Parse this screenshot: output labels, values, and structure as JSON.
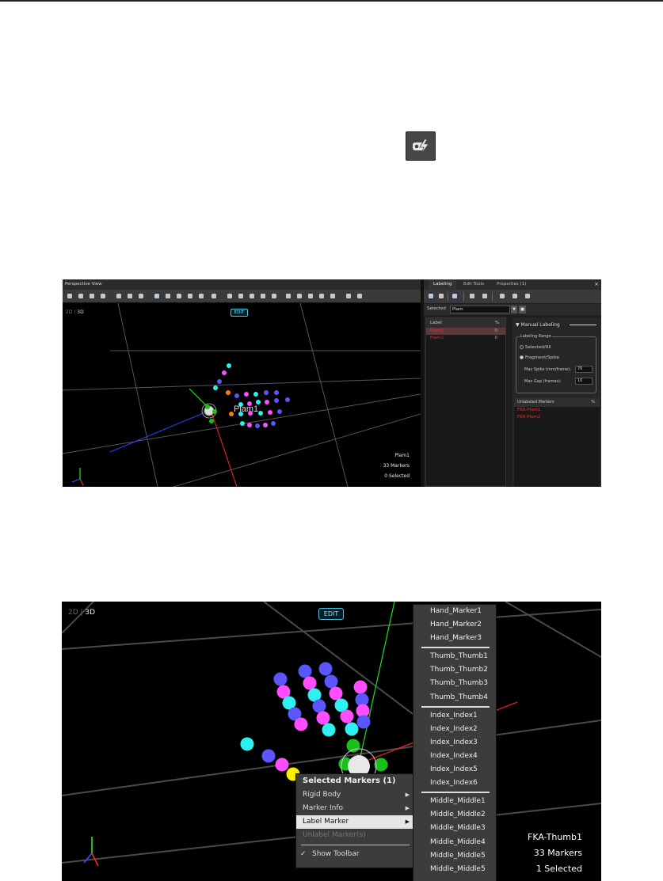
{
  "icon": {
    "name": "label-tool-icon"
  },
  "shot1": {
    "title": "Perspective View",
    "mode_2d": "2D",
    "mode_3d": "3D",
    "edit": "EDIT",
    "marker_label": "Plam1",
    "info": {
      "asset": "Plam1",
      "markers": "33 Markers",
      "selected": "0 Selected"
    },
    "panel": {
      "tabs": [
        "Labeling",
        "Edit Tools",
        "Properties (1)"
      ],
      "close": "×",
      "selected_label": "Selected",
      "selected_value": "Plam",
      "list_header": {
        "label": "Label",
        "pct": "%"
      },
      "labels": [
        {
          "name": "Plam1",
          "pct": "0"
        },
        {
          "name": "Plam2",
          "pct": "0"
        }
      ],
      "manual_labeling": "Manual Labeling",
      "range_title": "Labeling Range",
      "radio_1": "Selected/All",
      "radio_2": "Fragment/Spike",
      "max_spike_label": "Max Spike (mm/frame):",
      "max_spike_value": "70",
      "max_gap_label": "Max Gap (frames):",
      "max_gap_value": "10",
      "unlabeled_header": {
        "label": "Unlabeled Markers",
        "pct": "%"
      },
      "unlabeled": [
        "FKA-Plam1",
        "FKA-Plam2"
      ]
    }
  },
  "shot2": {
    "mode_2d": "2D",
    "mode_3d": "3D",
    "edit": "EDIT",
    "info": {
      "asset": "FKA-Thumb1",
      "markers": "33 Markers",
      "selected": "1 Selected"
    },
    "context_menu": {
      "header": "Selected Markers (1)",
      "items": [
        {
          "label": "Rigid Body",
          "submenu": true
        },
        {
          "label": "Marker Info",
          "submenu": true
        },
        {
          "label": "Label Marker",
          "submenu": true,
          "highlighted": true
        },
        {
          "label": "Unlabel Marker(s)",
          "disabled": true
        }
      ],
      "show_toolbar": "Show Toolbar",
      "check": "✓"
    },
    "submenu_groups": [
      [
        "Hand_Marker1",
        "Hand_Marker2",
        "Hand_Marker3"
      ],
      [
        "Thumb_Thumb1",
        "Thumb_Thumb2",
        "Thumb_Thumb3",
        "Thumb_Thumb4"
      ],
      [
        "Index_Index1",
        "Index_Index2",
        "Index_Index3",
        "Index_Index4",
        "Index_Index5",
        "Index_Index6"
      ],
      [
        "Middle_Middle1",
        "Middle_Middle2",
        "Middle_Middle3",
        "Middle_Middle4",
        "Middle_Middle5",
        "Middle_Middle5"
      ]
    ]
  },
  "colors": {
    "cyan": "#2ef0f0",
    "magenta": "#ff4dff",
    "blue": "#5a55ff",
    "green": "#19c019",
    "orange": "#ff7a10",
    "yellow": "#ffee00",
    "label_red": "#e03030",
    "edit_border": "#4cc9e0"
  }
}
